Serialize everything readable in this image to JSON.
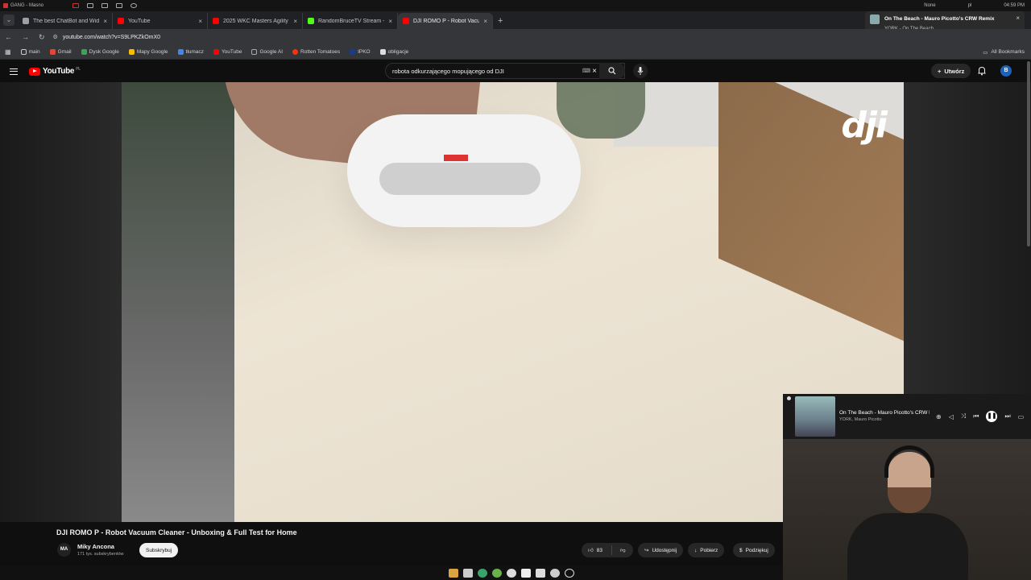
{
  "system": {
    "workspace": "GANG - Masno",
    "tray_user": "None",
    "tray_lang": "pl",
    "clock": "04:59 PM"
  },
  "tabs": [
    {
      "label": "The best ChatBot and Widget",
      "color": "#9aa0a6"
    },
    {
      "label": "YouTube",
      "color": "#ff0000"
    },
    {
      "label": "2025 WKC Masters Agility C",
      "color": "#ff0000"
    },
    {
      "label": "RandomBruceTV Stream - W",
      "color": "#53fc18"
    },
    {
      "label": "DJI ROMO P - Robot Vacuum",
      "color": "#ff0000",
      "active": true
    }
  ],
  "address": {
    "url": "youtube.com/watch?v=S9LPKZkOmX0"
  },
  "bookmarks": [
    {
      "label": "main",
      "color": "#8ab4f8"
    },
    {
      "label": "Gmail",
      "color": "#ea4335"
    },
    {
      "label": "Dysk Google",
      "color": "#34a853"
    },
    {
      "label": "Mapy Google",
      "color": "#fbbc04"
    },
    {
      "label": "tłumacz",
      "color": "#4285f4"
    },
    {
      "label": "YouTube",
      "color": "#ff0000"
    },
    {
      "label": "Google AI",
      "color": "#888"
    },
    {
      "label": "Rotten Tomatoes",
      "color": "#fa320a"
    },
    {
      "label": "IPKO",
      "color": "#1a3a8a"
    },
    {
      "label": "obligacje",
      "color": "#ddd"
    }
  ],
  "bookmarks_all": "All Bookmarks",
  "now_playing_popup": {
    "title": "On The Beach - Mauro Picotto's CRW Remix",
    "subtitle": "YORK - On The Beach"
  },
  "youtube": {
    "logo": "YouTube",
    "region": "PL",
    "search_value": "robota odkurzającego mopującego od DJI",
    "create_label": "Utwórz",
    "avatar_letter": "B"
  },
  "video": {
    "brand_overlay": "dji",
    "title": "DJI ROMO P - Robot Vacuum Cleaner - Unboxing & Full Test for Home",
    "channel": "Miky Ancona",
    "channel_initials": "MA",
    "subscribers": "171 tys. subskrybentów",
    "subscribe_label": "Subskrybuj",
    "likes": "83",
    "share_label": "Udostępnij",
    "download_label": "Pobierz",
    "thanks_label": "Podziękuj"
  },
  "mini_player": {
    "song": "On The Beach - Mauro Picotto's CRW Remix",
    "artist": "YORK, Mauro Picotto"
  },
  "dock_icons": [
    "files-icon",
    "terminal-icon",
    "browser-icon",
    "chrome-icon",
    "steam-icon",
    "discord-icon",
    "shield-icon",
    "obs-icon",
    "screenshot-icon"
  ]
}
